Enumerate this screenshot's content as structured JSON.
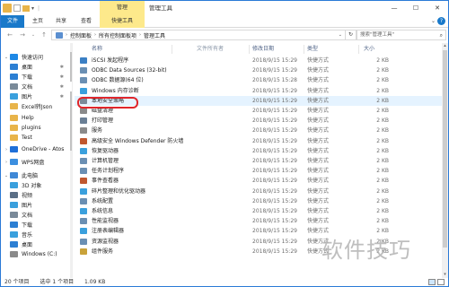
{
  "window": {
    "title": "管理工具",
    "context_tab": "管理"
  },
  "ribbon": {
    "tabs": [
      "文件",
      "主页",
      "共享",
      "查看",
      "快捷工具"
    ]
  },
  "address": {
    "crumbs": [
      "控制面板",
      "所有控制面板项",
      "管理工具"
    ],
    "search_placeholder": "搜索\"管理工具\""
  },
  "nav": {
    "items": [
      {
        "label": "快速访问",
        "icon": "star-icon",
        "color": "#1e88e5",
        "arrow": "⌄",
        "indent": 0
      },
      {
        "label": "桌面",
        "icon": "desktop-icon",
        "color": "#2c7fd3",
        "pin": true,
        "indent": 1
      },
      {
        "label": "下载",
        "icon": "download-icon",
        "color": "#2c7fd3",
        "pin": true,
        "indent": 1
      },
      {
        "label": "文档",
        "icon": "documents-icon",
        "color": "#7a8a99",
        "pin": true,
        "indent": 1
      },
      {
        "label": "图片",
        "icon": "pictures-icon",
        "color": "#3aa0dd",
        "pin": true,
        "indent": 1
      },
      {
        "label": "Excel转Json",
        "icon": "folder-icon",
        "color": "#e8b44a",
        "indent": 1
      },
      {
        "label": "Help",
        "icon": "folder-icon",
        "color": "#e8b44a",
        "indent": 1
      },
      {
        "label": "plugins",
        "icon": "folder-icon",
        "color": "#e8b44a",
        "indent": 1
      },
      {
        "label": "Test",
        "icon": "folder-icon",
        "color": "#e8b44a",
        "indent": 1
      },
      {
        "label": "OneDrive - Atos",
        "icon": "onedrive-icon",
        "color": "#1e6fd8",
        "arrow": "›",
        "indent": 0
      },
      {
        "label": "WPS网盘",
        "icon": "cloud-icon",
        "color": "#3c8fe0",
        "arrow": "›",
        "indent": 0
      },
      {
        "label": "此电脑",
        "icon": "computer-icon",
        "color": "#3f88d6",
        "arrow": "⌄",
        "indent": 0
      },
      {
        "label": "3D 对象",
        "icon": "3d-objects-icon",
        "color": "#3aa0dd",
        "indent": 1
      },
      {
        "label": "视频",
        "icon": "videos-icon",
        "color": "#5b6f86",
        "indent": 1
      },
      {
        "label": "图片",
        "icon": "pictures-icon",
        "color": "#3aa0dd",
        "indent": 1
      },
      {
        "label": "文档",
        "icon": "documents-icon",
        "color": "#7a8a99",
        "indent": 1
      },
      {
        "label": "下载",
        "icon": "download-icon",
        "color": "#2c7fd3",
        "indent": 1
      },
      {
        "label": "音乐",
        "icon": "music-icon",
        "color": "#3aa0dd",
        "indent": 1
      },
      {
        "label": "桌面",
        "icon": "desktop-icon",
        "color": "#2c7fd3",
        "indent": 1
      },
      {
        "label": "Windows (C:)",
        "icon": "drive-icon",
        "color": "#8a8a8a",
        "indent": 1
      }
    ]
  },
  "list": {
    "columns": {
      "name": "名称",
      "date": "修改日期",
      "type": "类型",
      "size": "大小",
      "note": "文件所有者"
    },
    "rows": [
      {
        "name": "iSCSI 发起程序",
        "date": "2018/9/15 15:29",
        "type": "快捷方式",
        "size": "2 KB",
        "color": "#3b7fc4"
      },
      {
        "name": "ODBC Data Sources (32-bit)",
        "date": "2018/9/15 15:29",
        "type": "快捷方式",
        "size": "2 KB",
        "color": "#6a8fb3"
      },
      {
        "name": "ODBC 数据源(64 位)",
        "date": "2018/9/15 15:28",
        "type": "快捷方式",
        "size": "2 KB",
        "color": "#6a8fb3"
      },
      {
        "name": "Windows 内存诊断",
        "date": "2018/9/15 15:29",
        "type": "快捷方式",
        "size": "2 KB",
        "color": "#3aa0dd"
      },
      {
        "name": "本地安全策略",
        "date": "2018/9/15 15:29",
        "type": "快捷方式",
        "size": "2 KB",
        "color": "#7a8a99",
        "selected": true
      },
      {
        "name": "磁盘清理",
        "date": "2018/9/15 15:29",
        "type": "快捷方式",
        "size": "2 KB",
        "color": "#8a8a8a"
      },
      {
        "name": "打印管理",
        "date": "2018/9/15 15:29",
        "type": "快捷方式",
        "size": "2 KB",
        "color": "#6a7f95"
      },
      {
        "name": "服务",
        "date": "2018/9/15 15:29",
        "type": "快捷方式",
        "size": "2 KB",
        "color": "#8a8a8a"
      },
      {
        "name": "高级安全 Windows Defender 防火墙",
        "date": "2018/9/15 15:29",
        "type": "快捷方式",
        "size": "2 KB",
        "color": "#c0572f"
      },
      {
        "name": "恢复驱动器",
        "date": "2018/9/15 15:29",
        "type": "快捷方式",
        "size": "2 KB",
        "color": "#3aa0dd"
      },
      {
        "name": "计算机管理",
        "date": "2018/9/15 15:29",
        "type": "快捷方式",
        "size": "2 KB",
        "color": "#6a8fb3"
      },
      {
        "name": "任务计划程序",
        "date": "2018/9/15 15:29",
        "type": "快捷方式",
        "size": "2 KB",
        "color": "#6a8fb3"
      },
      {
        "name": "事件查看器",
        "date": "2018/9/15 15:29",
        "type": "快捷方式",
        "size": "2 KB",
        "color": "#c0572f"
      },
      {
        "name": "碎片整理和优化驱动器",
        "date": "2018/9/15 15:29",
        "type": "快捷方式",
        "size": "2 KB",
        "color": "#3aa0dd"
      },
      {
        "name": "系统配置",
        "date": "2018/9/15 15:29",
        "type": "快捷方式",
        "size": "2 KB",
        "color": "#6a8fb3"
      },
      {
        "name": "系统信息",
        "date": "2018/9/15 15:29",
        "type": "快捷方式",
        "size": "2 KB",
        "color": "#3aa0dd"
      },
      {
        "name": "性能监视器",
        "date": "2018/9/15 15:29",
        "type": "快捷方式",
        "size": "2 KB",
        "color": "#6a8fb3"
      },
      {
        "name": "注册表编辑器",
        "date": "2018/9/15 15:29",
        "type": "快捷方式",
        "size": "2 KB",
        "color": "#3aa0dd"
      },
      {
        "name": "资源监视器",
        "date": "2018/9/15 15:29",
        "type": "快捷方式",
        "size": "2 KB",
        "color": "#6a8fb3"
      },
      {
        "name": "组件服务",
        "date": "2018/9/15 15:29",
        "type": "快捷方式",
        "size": "2 KB",
        "color": "#c9a23a"
      }
    ]
  },
  "status": {
    "count": "20 个项目",
    "selected": "选中 1 个项目",
    "size": "1.09 KB"
  },
  "watermark": "软件技巧"
}
